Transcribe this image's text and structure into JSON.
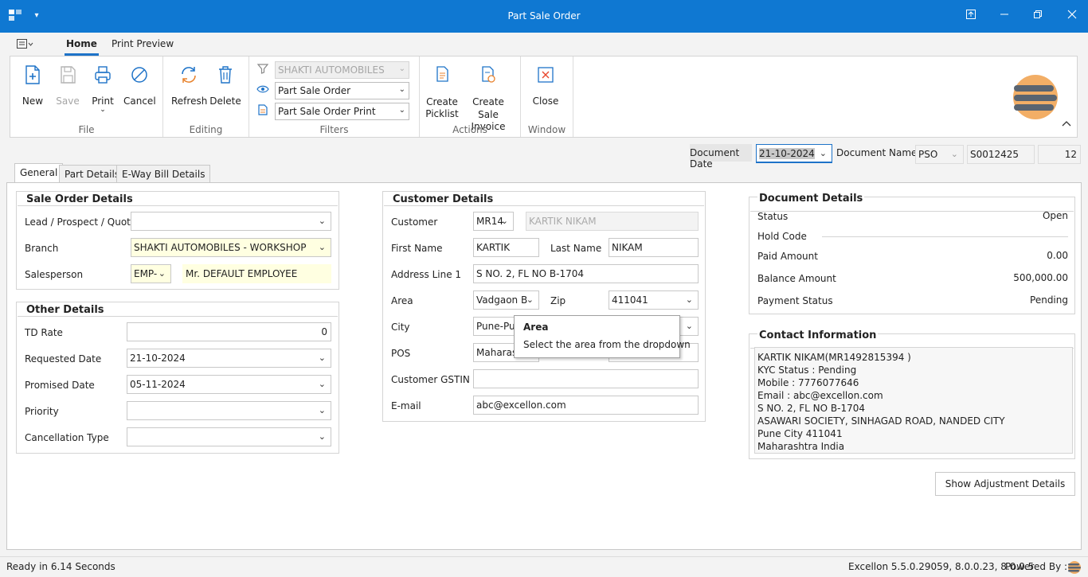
{
  "window": {
    "title": "Part Sale Order"
  },
  "ribbon_tabs": [
    "Home",
    "Print Preview"
  ],
  "ribbon": {
    "file": {
      "label": "File",
      "new": "New",
      "save": "Save",
      "print": "Print",
      "cancel": "Cancel"
    },
    "editing": {
      "label": "Editing",
      "refresh": "Refresh",
      "delete": "Delete"
    },
    "filters": {
      "label": "Filters",
      "company": "SHAKTI AUTOMOBILES",
      "view": "Part Sale Order",
      "print_format": "Part Sale Order Print"
    },
    "actions": {
      "label": "Actions",
      "create_picklist_1": "Create",
      "create_picklist_2": "Picklist",
      "create_invoice_1": "Create Sale",
      "create_invoice_2": "Invoice"
    },
    "window": {
      "label": "Window",
      "close": "Close"
    }
  },
  "document_header": {
    "date_label": "Document Date",
    "date_value": "21-10-2024",
    "name_label": "Document Name",
    "name_value": "PSO",
    "number": "S0012425",
    "count": "12"
  },
  "tabs": [
    "General",
    "Part Details",
    "E-Way Bill Details"
  ],
  "sale_order_details": {
    "title": "Sale Order Details",
    "lead_label": "Lead / Prospect / Quote",
    "lead_value": "",
    "branch_label": "Branch",
    "branch_value": "SHAKTI AUTOMOBILES - WORKSHOP",
    "salesperson_label": "Salesperson",
    "salesperson_code": "EMP-",
    "salesperson_name": "Mr. DEFAULT EMPLOYEE"
  },
  "other_details": {
    "title": "Other Details",
    "td_rate_label": "TD Rate",
    "td_rate_value": "0",
    "requested_label": "Requested Date",
    "requested_value": "21-10-2024",
    "promised_label": "Promised Date",
    "promised_value": "05-11-2024",
    "priority_label": "Priority",
    "priority_value": "",
    "cancellation_label": "Cancellation Type",
    "cancellation_value": ""
  },
  "customer_details": {
    "title": "Customer Details",
    "customer_label": "Customer",
    "customer_code": "MR14",
    "customer_name": "KARTIK  NIKAM",
    "first_name_label": "First Name",
    "first_name": "KARTIK",
    "last_name_label": "Last Name",
    "last_name": "NIKAM",
    "address_label": "Address Line 1",
    "address": "S NO. 2, FL NO B-1704",
    "area_label": "Area",
    "area": "Vadgaon B",
    "zip_label": "Zip",
    "zip": "411041",
    "city_label": "City",
    "city": "Pune-Pu",
    "pos_label": "POS",
    "pos": "Maharas",
    "gstin_label": "Customer GSTIN",
    "gstin": "",
    "email_label": "E-mail",
    "email": "abc@excellon.com"
  },
  "tooltip": {
    "title": "Area",
    "text": "Select the area from the dropdown"
  },
  "document_details": {
    "title": "Document Details",
    "status_label": "Status",
    "status": "Open",
    "hold_label": "Hold Code",
    "paid_label": "Paid Amount",
    "paid": "0.00",
    "balance_label": "Balance Amount",
    "balance": "500,000.00",
    "payment_label": "Payment Status",
    "payment": "Pending"
  },
  "contact_information": {
    "title": "Contact Information",
    "lines": [
      "KARTIK  NIKAM(MR1492815394 )",
      "KYC Status : Pending",
      "Mobile : 7776077646",
      "Email : abc@excellon.com",
      "S NO. 2, FL NO B-1704",
      "ASAWARI SOCIETY, SINHAGAD ROAD, NANDED CITY",
      "Pune City 411041",
      "Maharashtra India"
    ]
  },
  "adjustment_button": "Show Adjustment Details",
  "status_bar": {
    "ready": "Ready in 6.14 Seconds",
    "version": "Excellon 5.5.0.29059, 8.0.0.23, 8.0.0.5",
    "powered": "Powered By :"
  },
  "colors": {
    "titlebar": "#0f78d2",
    "accent": "#1e73c8",
    "field_highlight": "#ffffe1"
  }
}
